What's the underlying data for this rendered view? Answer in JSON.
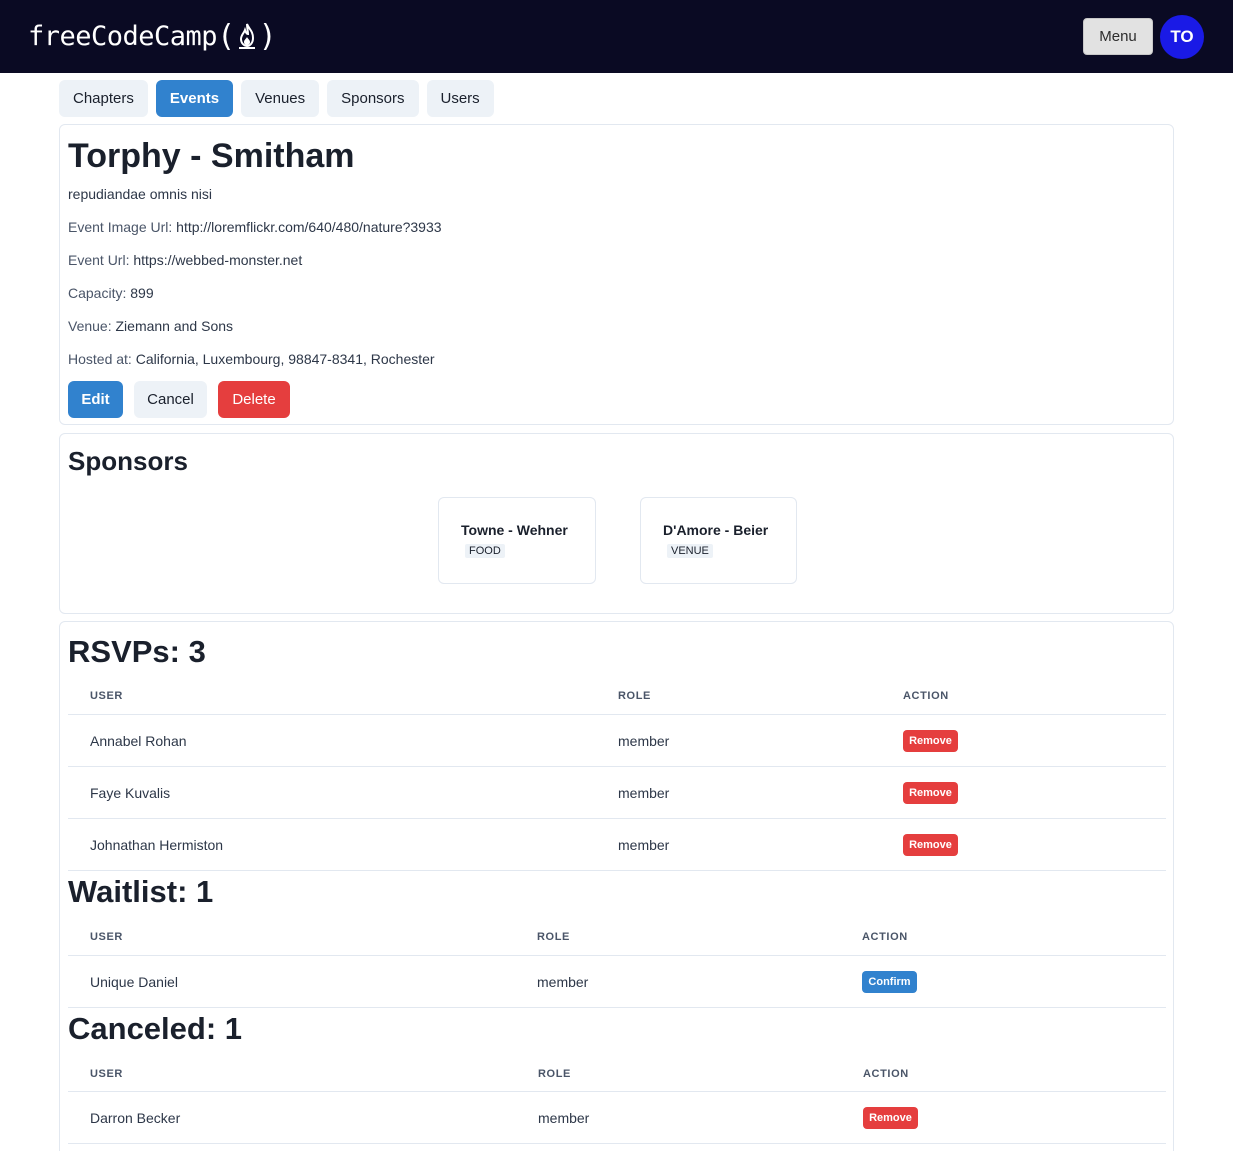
{
  "header": {
    "logo_text": "freeCodeCamp",
    "logo_paren_open": "(",
    "logo_paren_close": ")",
    "menu_label": "Menu",
    "avatar_initials": "TO"
  },
  "tabs": [
    {
      "label": "Chapters",
      "active": false
    },
    {
      "label": "Events",
      "active": true
    },
    {
      "label": "Venues",
      "active": false
    },
    {
      "label": "Sponsors",
      "active": false
    },
    {
      "label": "Users",
      "active": false
    }
  ],
  "event": {
    "title": "Torphy - Smitham",
    "description": "repudiandae omnis nisi",
    "image_url_label": "Event Image Url:",
    "image_url": "http://loremflickr.com/640/480/nature?3933",
    "url_label": "Event Url:",
    "url": "https://webbed-monster.net",
    "capacity_label": "Capacity:",
    "capacity": "899",
    "venue_label": "Venue:",
    "venue": "Ziemann and Sons",
    "hosted_label": "Hosted at:",
    "hosted": "California, Luxembourg, 98847-8341, Rochester",
    "edit_label": "Edit",
    "cancel_label": "Cancel",
    "delete_label": "Delete"
  },
  "sponsors": {
    "title": "Sponsors",
    "items": [
      {
        "name": "Towne - Wehner",
        "type": "FOOD"
      },
      {
        "name": "D'Amore - Beier",
        "type": "VENUE"
      }
    ]
  },
  "rsvps": {
    "title": "RSVPs: 3",
    "headers": [
      "USER",
      "ROLE",
      "ACTION"
    ],
    "rows": [
      {
        "user": "Annabel Rohan",
        "role": "member",
        "action": "Remove"
      },
      {
        "user": "Faye Kuvalis",
        "role": "member",
        "action": "Remove"
      },
      {
        "user": "Johnathan Hermiston",
        "role": "member",
        "action": "Remove"
      }
    ]
  },
  "waitlist": {
    "title": "Waitlist: 1",
    "headers": [
      "USER",
      "ROLE",
      "ACTION"
    ],
    "rows": [
      {
        "user": "Unique Daniel",
        "role": "member",
        "action": "Confirm"
      }
    ]
  },
  "canceled": {
    "title": "Canceled: 1",
    "headers": [
      "USER",
      "ROLE",
      "ACTION"
    ],
    "rows": [
      {
        "user": "Darron Becker",
        "role": "member",
        "action": "Remove"
      }
    ]
  },
  "colors": {
    "topbar": "#0a0a23",
    "primary": "#3182ce",
    "danger": "#e53e3e",
    "avatar": "#1a1ae6"
  }
}
